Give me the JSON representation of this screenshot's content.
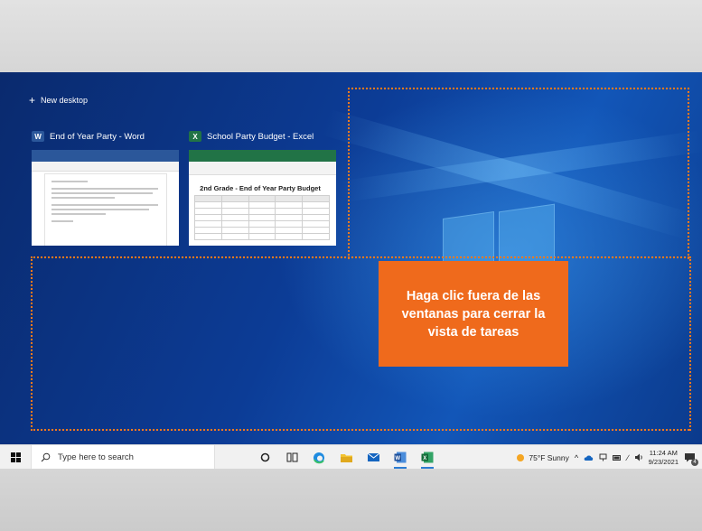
{
  "task_view": {
    "new_desktop_label": "New desktop",
    "windows": [
      {
        "title": "End of Year Party - Word",
        "app_icon": "W",
        "icon_color": "#2b579a"
      },
      {
        "title": "School Party Budget - Excel",
        "app_icon": "X",
        "icon_color": "#217346"
      }
    ],
    "excel_preview_heading": "2nd Grade - End of Year Party Budget"
  },
  "callout": {
    "text": "Haga clic fuera de las ventanas para cerrar la vista de tareas",
    "color": "#ef6a1c"
  },
  "highlight_color": "#ff7a1a",
  "taskbar": {
    "search_placeholder": "Type here to search",
    "weather": "75°F  Sunny",
    "time": "11:24 AM",
    "date": "9/23/2021",
    "notification_count": "4"
  }
}
